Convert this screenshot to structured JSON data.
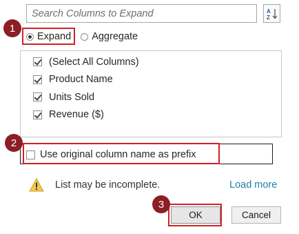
{
  "search": {
    "placeholder": "Search Columns to Expand"
  },
  "sort_button": {
    "icon": "sort-az-icon"
  },
  "mode": {
    "options": [
      {
        "label": "Expand",
        "checked": true
      },
      {
        "label": "Aggregate",
        "checked": false
      }
    ]
  },
  "columns": {
    "items": [
      {
        "label": "(Select All Columns)",
        "checked": true
      },
      {
        "label": "Product Name",
        "checked": true
      },
      {
        "label": "Units Sold",
        "checked": true
      },
      {
        "label": "Revenue ($)",
        "checked": true
      }
    ]
  },
  "prefix": {
    "label": "Use original column name as prefix",
    "checked": false
  },
  "warning": {
    "icon": "warning-icon",
    "text": "List may be incomplete."
  },
  "load_more": "Load more",
  "buttons": {
    "ok": "OK",
    "cancel": "Cancel"
  },
  "annotations": {
    "badge1": "1",
    "badge2": "2",
    "badge3": "3"
  },
  "colors": {
    "highlight": "#d31f26",
    "badge": "#8b1f25",
    "link": "#1f7fa8"
  }
}
